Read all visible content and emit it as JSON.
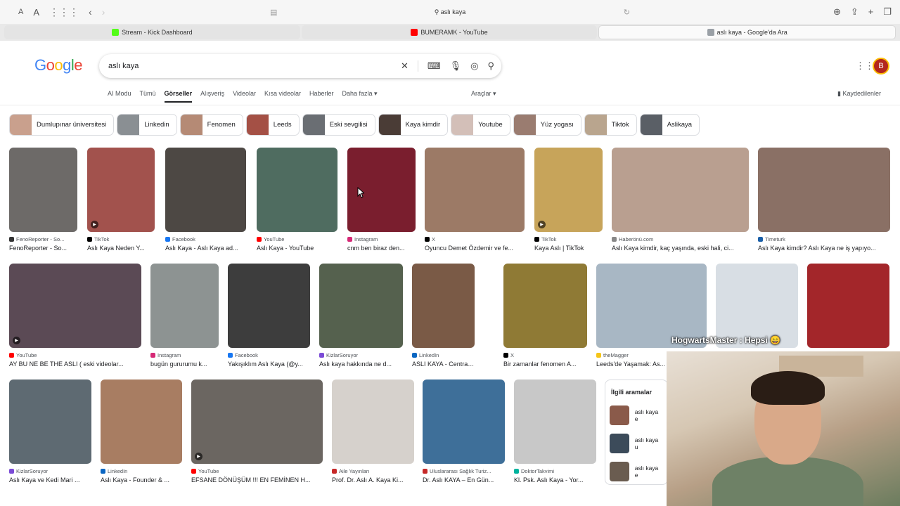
{
  "browser": {
    "address": "aslı kaya",
    "font_small": "A",
    "font_large": "A",
    "tabs": [
      {
        "label": "Stream - Kick Dashboard",
        "color": "#53fc18"
      },
      {
        "label": "BUMERAMK - YouTube",
        "color": "#ff0000"
      },
      {
        "label": "aslı kaya - Google'da Ara",
        "color": "#9aa0a6"
      }
    ]
  },
  "google": {
    "logo": [
      "G",
      "o",
      "o",
      "g",
      "l",
      "e"
    ],
    "query": "aslı kaya",
    "avatar_letter": "B",
    "nav": [
      "AI Modu",
      "Tümü",
      "Görseller",
      "Alışveriş",
      "Videolar",
      "Kısa videolar",
      "Haberler",
      "Daha fazla ▾"
    ],
    "tools": "Araçlar ▾",
    "saved": "Kaydedilenler"
  },
  "chips": [
    {
      "label": "Dumlupınar üniversitesi",
      "color": "#c9a08d"
    },
    {
      "label": "Linkedin",
      "color": "#8a8f93"
    },
    {
      "label": "Fenomen",
      "color": "#b58a75"
    },
    {
      "label": "Leeds",
      "color": "#a45045"
    },
    {
      "label": "Eski sevgilisi",
      "color": "#6a6e73"
    },
    {
      "label": "Kaya kimdir",
      "color": "#4a3c36"
    },
    {
      "label": "Youtube",
      "color": "#d3bfb8"
    },
    {
      "label": "Yüz yogası",
      "color": "#9a7c70"
    },
    {
      "label": "Tiktok",
      "color": "#b9a58e"
    },
    {
      "label": "Aslikaya",
      "color": "#5a5f66"
    }
  ],
  "images_row1": [
    {
      "src": "FenoReporter - So...",
      "title": "FenoReporter - So...",
      "color": "#6d6a68",
      "fav": "#333"
    },
    {
      "src": "TikTok",
      "title": "Aslı Kaya Neden Y...",
      "color": "#a2524d",
      "fav": "#000",
      "video": true
    },
    {
      "src": "Facebook",
      "title": "Aslı Kaya - Aslı Kaya ad...",
      "color": "#4d4844",
      "fav": "#1877f2"
    },
    {
      "src": "YouTube",
      "title": "Aslı Kaya - YouTube",
      "color": "#4f6c60",
      "fav": "#ff0000"
    },
    {
      "src": "Instagram",
      "title": "cnm ben biraz den...",
      "color": "#7a1e2e",
      "fav": "#d62976"
    },
    {
      "src": "X",
      "title": "Oyuncu Demet Özdemir ve fe...",
      "color": "#9c7a66",
      "fav": "#000"
    },
    {
      "src": "TikTok",
      "title": "Kaya Aslı | TikTok",
      "color": "#c7a45a",
      "fav": "#000",
      "video": true
    },
    {
      "src": "Haberönü.com",
      "title": "Aslı Kaya kimdir, kaç yaşında, eski hali, ci...",
      "color": "#b99f90",
      "fav": "#888"
    },
    {
      "src": "Timeturk",
      "title": "Aslı Kaya kimdir? Aslı Kaya ne iş yapıyo...",
      "color": "#8a7065",
      "fav": "#1a5fa8"
    }
  ],
  "images_row2": [
    {
      "src": "YouTube",
      "title": "AY BU NE BE THE ASLI ( eski videolar...",
      "color": "#5b4a55",
      "fav": "#ff0000",
      "video": true
    },
    {
      "src": "Instagram",
      "title": "bugün gururumu k...",
      "color": "#8d9392",
      "fav": "#d62976"
    },
    {
      "src": "Facebook",
      "title": "Yakışıklım Aslı Kaya (@y...",
      "color": "#3d3d3d",
      "fav": "#1877f2"
    },
    {
      "src": "KizlarSoruyor",
      "title": "Aslı kaya hakkında ne d...",
      "color": "#55614e",
      "fav": "#7b4bd6"
    },
    {
      "src": "LinkedIn",
      "title": "ASLI KAYA - Central Ba...",
      "color": "#7a5a46",
      "fav": "#0a66c2"
    },
    {
      "src": "X",
      "title": "Bir zamanlar fenomen A...",
      "color": "#8f7a35",
      "fav": "#000"
    },
    {
      "src": "theMagger",
      "title": "Leeds'de Yaşamak: As...",
      "color": "#a8b7c4",
      "fav": "#f5c518"
    },
    {
      "src": "",
      "title": "",
      "color": "#d8dee4",
      "fav": "#fff"
    },
    {
      "src": "",
      "title": "",
      "color": "#a3262a",
      "fav": "#fff"
    }
  ],
  "images_row3": [
    {
      "src": "KizlarSoruyor",
      "title": "Aslı Kaya ve Kedi Mari ...",
      "color": "#5e6a72",
      "fav": "#7b4bd6"
    },
    {
      "src": "LinkedIn",
      "title": "Aslı Kaya - Founder & ...",
      "color": "#a87d62",
      "fav": "#0a66c2"
    },
    {
      "src": "YouTube",
      "title": "EFSANE DÖNÜŞÜM !!! EN FEMİNEN H...",
      "color": "#6b6661",
      "fav": "#ff0000",
      "video": true
    },
    {
      "src": "Aile Yayınları",
      "title": "Prof. Dr. Aslı A. Kaya Ki...",
      "color": "#d6d1cc",
      "fav": "#c62828"
    },
    {
      "src": "Uluslararası Sağlık Turiz...",
      "title": "Dr. Aslı KAYA – En Gün...",
      "color": "#3e6f99",
      "fav": "#c62828"
    },
    {
      "src": "DoktorTakvimi",
      "title": "Kl. Psk. Aslı Kaya - Yor...",
      "color": "#c8c8c8",
      "fav": "#00b39e"
    }
  ],
  "related": {
    "heading": "İlgili aramalar",
    "items": [
      {
        "label": "aslı kaya e",
        "color": "#8a5a4a"
      },
      {
        "label": "aslı kaya u",
        "color": "#3c4b5a"
      },
      {
        "label": "aslı kaya e",
        "color": "#6a5c50"
      }
    ]
  },
  "stream_overlay": "HogwartsMaster : Hepsi 😄"
}
